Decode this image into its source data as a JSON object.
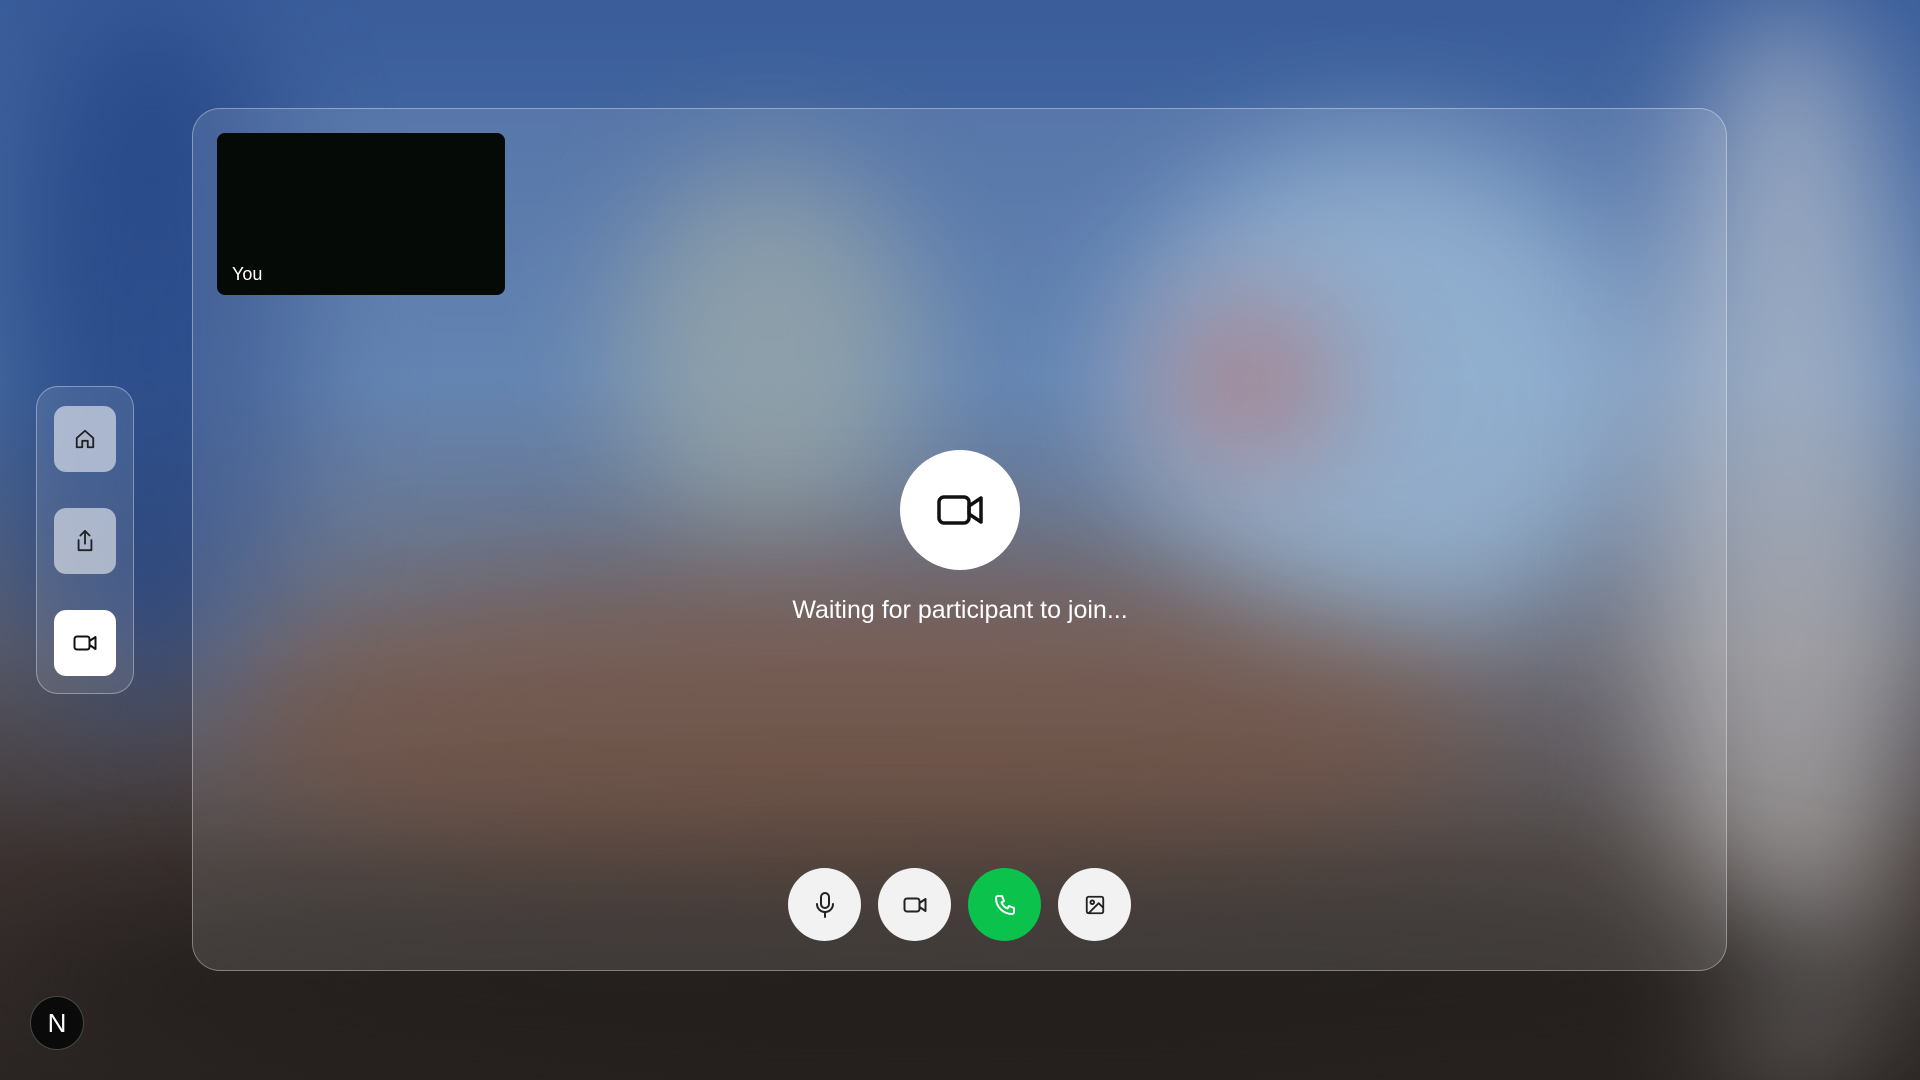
{
  "self_view": {
    "label": "You"
  },
  "status": {
    "waiting_text": "Waiting for participant to join..."
  },
  "sidebar": {
    "items": [
      {
        "icon": "home-icon",
        "active": false
      },
      {
        "icon": "share-icon",
        "active": false
      },
      {
        "icon": "video-camera-icon",
        "active": true
      }
    ]
  },
  "controls": {
    "items": [
      {
        "icon": "microphone-icon",
        "color": "#f2f2f2"
      },
      {
        "icon": "video-camera-icon",
        "color": "#f2f2f2"
      },
      {
        "icon": "phone-icon",
        "color": "#0bc24c"
      },
      {
        "icon": "image-icon",
        "color": "#f2f2f2"
      }
    ]
  },
  "badge": {
    "letter": "N"
  },
  "colors": {
    "accent_call": "#0bc24c",
    "self_view_bg": "#060a06"
  }
}
